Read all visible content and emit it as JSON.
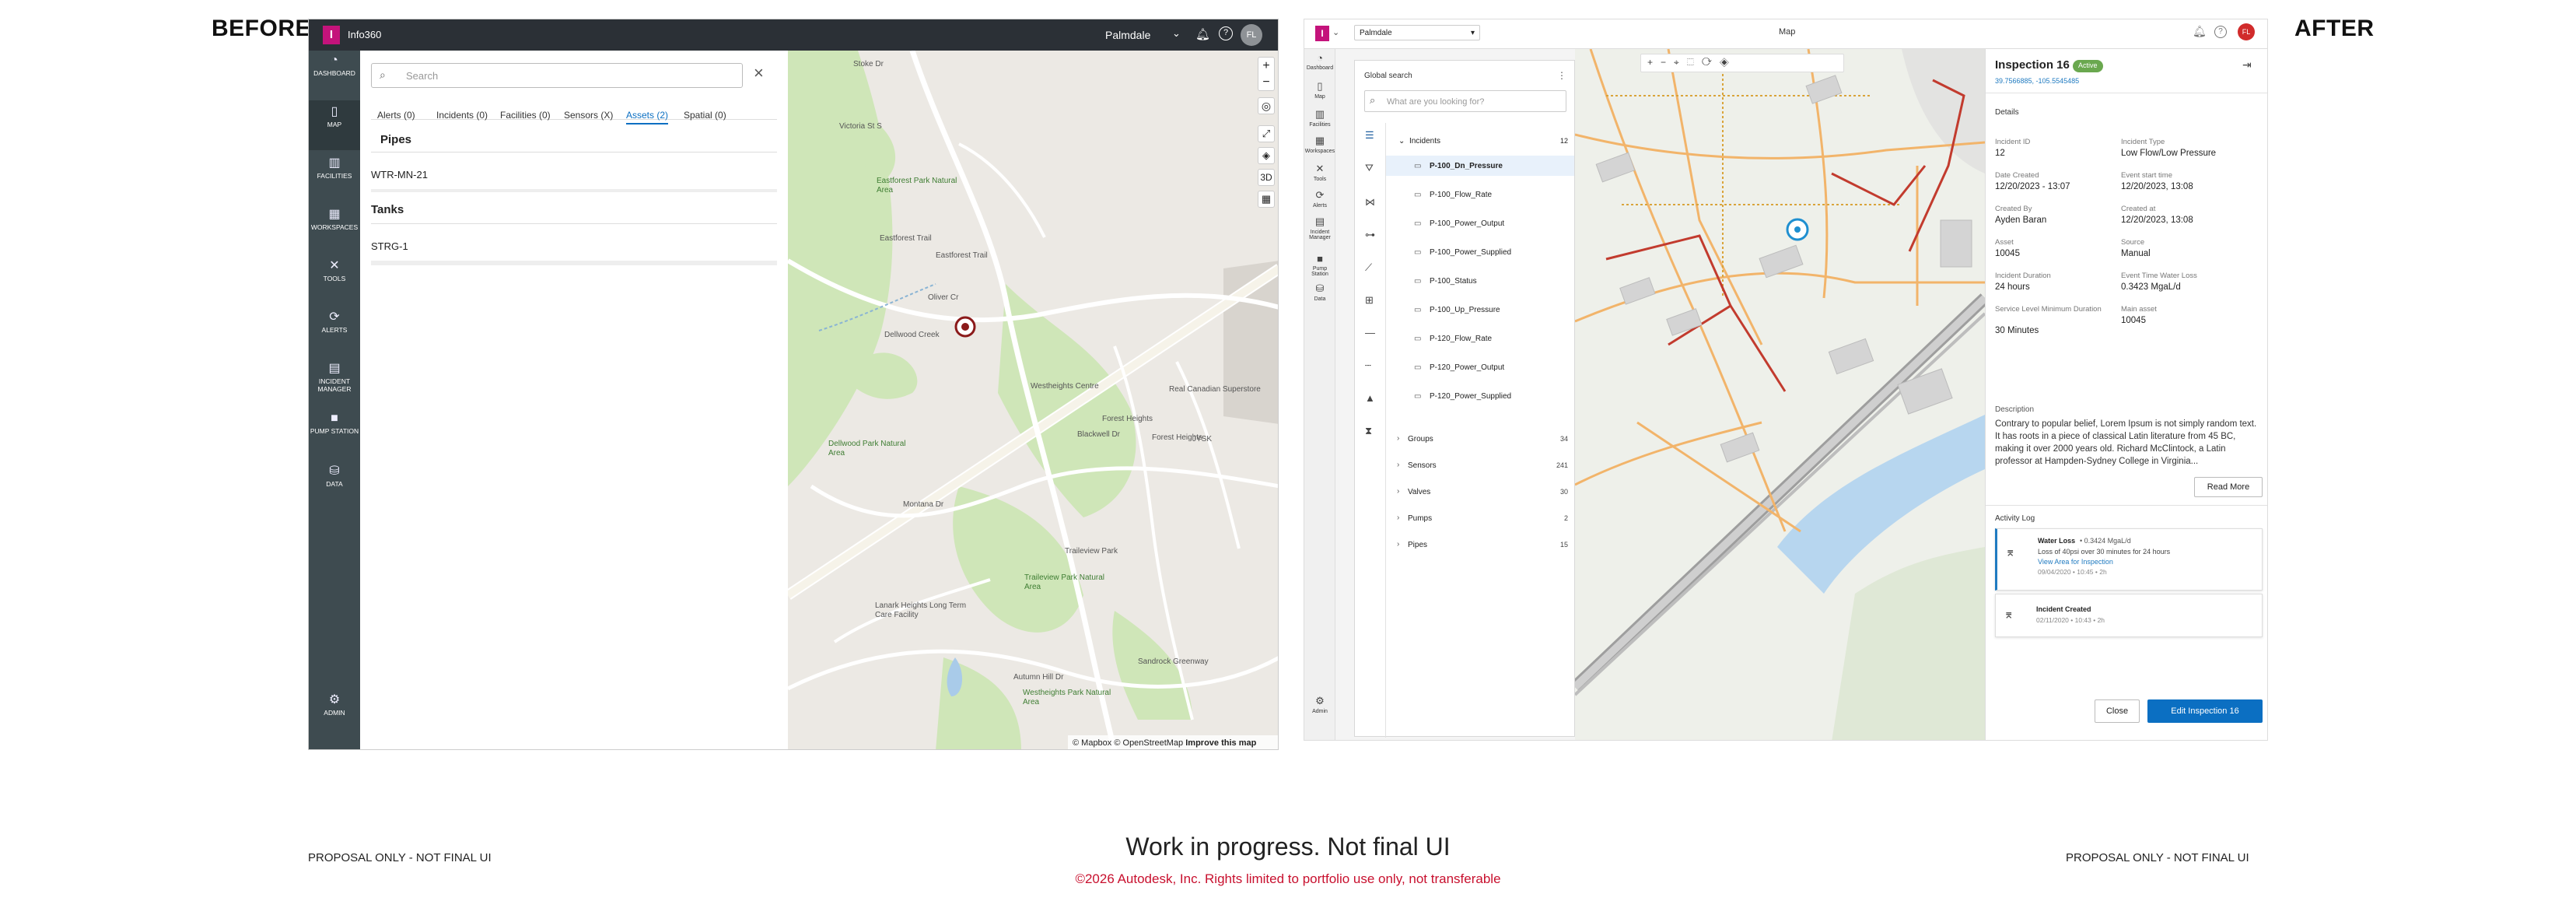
{
  "captions": {
    "before": "BEFORE",
    "after": "AFTER",
    "left_note": "PROPOSAL ONLY - NOT FINAL UI",
    "right_note": "PROPOSAL ONLY - NOT FINAL UI",
    "center_title": "Work in progress. Not final UI",
    "copyright": "©2026 Autodesk, Inc. Rights limited to portfolio use only, not transferable"
  },
  "before": {
    "app_title": "Info360",
    "location": "Palmdale",
    "avatar": "FL",
    "sidebar": [
      {
        "label": "DASHBOARD",
        "icon": "dashboard-icon"
      },
      {
        "label": "MAP",
        "icon": "map-icon"
      },
      {
        "label": "FACILITIES",
        "icon": "facilities-icon"
      },
      {
        "label": "WORKSPACES",
        "icon": "workspaces-icon"
      },
      {
        "label": "TOOLS",
        "icon": "tools-icon"
      },
      {
        "label": "ALERTS",
        "icon": "alerts-icon"
      },
      {
        "label": "INCIDENT MANAGER",
        "icon": "incident-icon"
      },
      {
        "label": "PUMP STATION",
        "icon": "pump-icon"
      },
      {
        "label": "DATA",
        "icon": "data-icon"
      },
      {
        "label": "ADMIN",
        "icon": "admin-icon"
      }
    ],
    "search_placeholder": "Search",
    "tabs": [
      "Alerts (0)",
      "Incidents (0)",
      "Facilities (0)",
      "Sensors (X)",
      "Assets (2)",
      "Spatial (0)"
    ],
    "groups": [
      {
        "title": "Pipes",
        "item": "WTR-MN-21"
      },
      {
        "title": "Tanks",
        "item": "STRG-1"
      }
    ],
    "map_labels": [
      "Victoria St S",
      "Eastforest Park Natural Area",
      "Eastforest Trail",
      "Eastforest Trail",
      "Oliver Cr",
      "Dellwood Creek",
      "Westheights Centre",
      "Real Canadian Superstore",
      "Forest Heights",
      "Forest Heights",
      "Blackwell Dr",
      "Dellwood Park Natural Area",
      "Montana Dr",
      "Traileview Park",
      "Traileview Park Natural Area",
      "Lanark Heights Long Term Care Facility",
      "Sandrock Greenway",
      "Autumn Hill Dr",
      "Westheights Park Natural Area",
      "JYSK",
      "Stoke Dr"
    ],
    "attribution": "© Mapbox © OpenStreetMap",
    "improve": "Improve this map"
  },
  "after": {
    "app_title": "Palmdale",
    "center_title": "Map",
    "avatar": "FL",
    "rail": [
      {
        "label": "Dashboard",
        "icon": "dashboard-icon"
      },
      {
        "label": "Map",
        "icon": "map-icon"
      },
      {
        "label": "Facilities",
        "icon": "facilities-icon"
      },
      {
        "label": "Workspaces",
        "icon": "workspaces-icon"
      },
      {
        "label": "Tools",
        "icon": "tools-icon"
      },
      {
        "label": "Alerts",
        "icon": "alerts-icon"
      },
      {
        "label": "Incident Manager",
        "icon": "incident-icon"
      },
      {
        "label": "Pump Station",
        "icon": "pump-icon"
      },
      {
        "label": "Data",
        "icon": "data-icon"
      },
      {
        "label": "Admin",
        "icon": "admin-icon"
      }
    ],
    "global_search": "Global search",
    "search_placeholder": "What are you looking for?",
    "incidents": {
      "label": "Incidents",
      "count": "12",
      "items": [
        "P-100_Dn_Pressure",
        "P-100_Flow_Rate",
        "P-100_Power_Output",
        "P-100_Power_Supplied",
        "P-100_Status",
        "P-100_Up_Pressure",
        "P-120_Flow_Rate",
        "P-120_Power_Output",
        "P-120_Power_Supplied"
      ]
    },
    "groups": [
      {
        "label": "Groups",
        "count": "34"
      },
      {
        "label": "Sensors",
        "count": "241"
      },
      {
        "label": "Valves",
        "count": "30"
      },
      {
        "label": "Pumps",
        "count": "2"
      },
      {
        "label": "Pipes",
        "count": "15"
      }
    ],
    "detail": {
      "title": "Inspection 16",
      "badge": "Active",
      "coords": "39.7566885, -105.5545485",
      "section": "Details",
      "fields": [
        {
          "label": "Incident ID",
          "value": "12"
        },
        {
          "label": "Incident Type",
          "value": "Low Flow/Low Pressure"
        },
        {
          "label": "Date Created",
          "value": "12/20/2023 - 13:07"
        },
        {
          "label": "Event start time",
          "value": "12/20/2023, 13:08"
        },
        {
          "label": "Created By",
          "value": "Ayden Baran"
        },
        {
          "label": "Created at",
          "value": "12/20/2023, 13:08"
        },
        {
          "label": "Asset",
          "value": "10045"
        },
        {
          "label": "Source",
          "value": "Manual"
        },
        {
          "label": "Incident Duration",
          "value": "24 hours"
        },
        {
          "label": "Event Time Water Loss",
          "value": "0.3423 MgaL/d"
        },
        {
          "label": "Service Level Minimum Duration",
          "value": "30 Minutes"
        },
        {
          "label": "Main asset",
          "value": "10045"
        }
      ],
      "description_label": "Description",
      "description": "Contrary to popular belief, Lorem Ipsum is not simply random text. It has roots in a piece of classical Latin literature from 45 BC, making it over 2000 years old. Richard McClintock, a Latin professor at Hampden-Sydney College in Virginia...",
      "read_more": "Read More",
      "activity_log": "Activity Log",
      "log": [
        {
          "title": "Water Loss",
          "extra": "• 0.3424 MgaL/d",
          "line": "Loss of 40psi over 30 minutes for 24 hours",
          "link": "View Area for Inspection",
          "time": "09/04/2020 • 10:45 • 2h"
        },
        {
          "title": "Incident Created",
          "extra": "",
          "line": "",
          "link": "",
          "time": "02/11/2020 • 10:43 • 2h"
        }
      ],
      "close": "Close",
      "edit": "Edit Inspection 16"
    }
  }
}
